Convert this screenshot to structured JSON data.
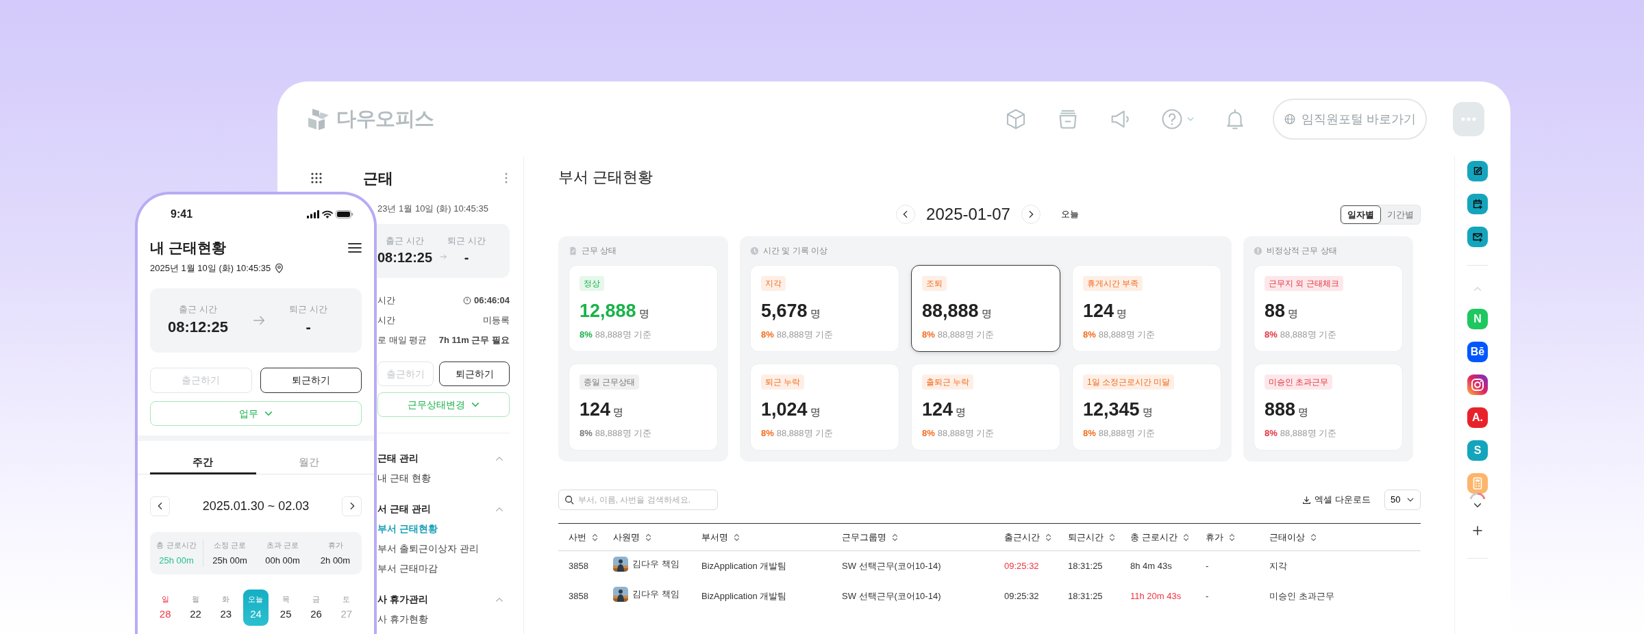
{
  "header": {
    "logo": "다우오피스",
    "portal_button": "임직원포털 바로가기"
  },
  "sidebar": {
    "title": "근태",
    "datetime": "23년 1월 10일 (화) 10:45:35",
    "clock_in_label": "출근 시간",
    "clock_in": "08:12:25",
    "clock_out_label": "퇴근 시간",
    "clock_out": "-",
    "stats": [
      {
        "label": "시간",
        "value": "06:46:04",
        "kind": "timer"
      },
      {
        "label": "시간",
        "value": "미등록",
        "kind": "plain"
      },
      {
        "label": "로 매일 평균",
        "value": "7h 11m 근무 필요",
        "kind": "bold"
      }
    ],
    "buttons": [
      {
        "label": "출근하기",
        "disabled": true
      },
      {
        "label": "퇴근하기",
        "disabled": false
      }
    ],
    "status_button": "근무상태변경",
    "menu": [
      {
        "title": "근태 관리",
        "expanded": true,
        "items": [
          {
            "label": "내 근태 현황",
            "selected": false
          }
        ]
      },
      {
        "title": "서 근태 관리",
        "expanded": true,
        "items": [
          {
            "label": "부서 근태현황",
            "selected": true
          },
          {
            "label": "부서 출퇴근이상자 관리",
            "selected": false
          },
          {
            "label": "부서 근태마감",
            "selected": false
          }
        ]
      },
      {
        "title": "사 휴가관리",
        "expanded": true,
        "items": [
          {
            "label": "사 휴가현황",
            "selected": false
          }
        ]
      }
    ]
  },
  "main": {
    "title": "부서 근태현황",
    "date": "2025-01-07",
    "today_button": "오늘",
    "view_toggle": [
      {
        "label": "일자별",
        "selected": true
      },
      {
        "label": "기간별",
        "selected": false
      }
    ],
    "groups": [
      {
        "title": "근무 상태",
        "kind": "document",
        "cards": [
          {
            "badge": "정상",
            "color": "#19b34a",
            "highlight": true,
            "count": "12,888",
            "unit": "명",
            "percent": "8%",
            "basis": "88,888명 기준",
            "selected": false
          },
          {
            "badge": "종일 근무상태",
            "color": "#777777",
            "highlight": false,
            "count": "124",
            "unit": "명",
            "percent": "8%",
            "basis": "88,888명 기준",
            "selected": false
          }
        ]
      },
      {
        "title": "시간 및 기록 이상",
        "kind": "clock",
        "cards": [
          {
            "badge": "지각",
            "color": "#f26b1d",
            "highlight": false,
            "count": "5,678",
            "unit": "명",
            "percent": "8%",
            "basis": "88,888명 기준",
            "selected": false
          },
          {
            "badge": "조퇴",
            "color": "#f26b1d",
            "highlight": false,
            "count": "88,888",
            "unit": "명",
            "percent": "8%",
            "basis": "88,888명 기준",
            "selected": true
          },
          {
            "badge": "휴게시간 부족",
            "color": "#f26b1d",
            "highlight": false,
            "count": "124",
            "unit": "명",
            "percent": "8%",
            "basis": "88,888명 기준",
            "selected": false
          },
          {
            "badge": "퇴근 누락",
            "color": "#f26b1d",
            "highlight": false,
            "count": "1,024",
            "unit": "명",
            "percent": "8%",
            "basis": "88,888명 기준",
            "selected": false
          },
          {
            "badge": "출퇴근 누락",
            "color": "#f26b1d",
            "highlight": false,
            "count": "124",
            "unit": "명",
            "percent": "8%",
            "basis": "88,888명 기준",
            "selected": false
          },
          {
            "badge": "1일 소정근로시간 미달",
            "color": "#f26b1d",
            "highlight": false,
            "count": "12,345",
            "unit": "명",
            "percent": "8%",
            "basis": "88,888명 기준",
            "selected": false
          }
        ]
      },
      {
        "title": "비정상적 근무 상태",
        "kind": "alert",
        "cards": [
          {
            "badge": "근무지 외 근태체크",
            "color": "#e5323f",
            "highlight": false,
            "count": "88",
            "unit": "명",
            "percent": "8%",
            "basis": "88,888명 기준",
            "selected": false
          },
          {
            "badge": "미승인 초과근무",
            "color": "#e5323f",
            "highlight": false,
            "count": "888",
            "unit": "명",
            "percent": "8%",
            "basis": "88,888명 기준",
            "selected": false
          }
        ]
      }
    ],
    "search": {
      "placeholder": "부서, 이름, 사번을 검색하세요."
    },
    "download_button": "엑셀 다운로드",
    "page_size": "50",
    "table": {
      "columns": [
        "사번",
        "사원명",
        "부서명",
        "근무그룹명",
        "출근시간",
        "퇴근시간",
        "총 근로시간",
        "휴가",
        "근태이상"
      ],
      "rows": [
        {
          "cells": [
            {
              "text": "3858",
              "alert": false
            },
            {
              "text": "김다우 책임",
              "alert": false
            },
            {
              "text": "BizApplication 개발팀",
              "alert": false
            },
            {
              "text": "SW 선택근무(코어10-14)",
              "alert": false
            },
            {
              "text": "09:25:32",
              "alert": true
            },
            {
              "text": "18:31:25",
              "alert": false
            },
            {
              "text": "8h 4m 43s",
              "alert": false
            },
            {
              "text": "-",
              "alert": false
            },
            {
              "text": "지각",
              "alert": false
            }
          ]
        },
        {
          "cells": [
            {
              "text": "3858",
              "alert": false
            },
            {
              "text": "김다우 책임",
              "alert": false
            },
            {
              "text": "BizApplication 개발팀",
              "alert": false
            },
            {
              "text": "SW 선택근무(코어10-14)",
              "alert": false
            },
            {
              "text": "09:25:32",
              "alert": false
            },
            {
              "text": "18:31:25",
              "alert": false
            },
            {
              "text": "11h 20m 43s",
              "alert": true
            },
            {
              "text": "-",
              "alert": false
            },
            {
              "text": "미승인 초과근무",
              "alert": false
            }
          ]
        }
      ]
    }
  },
  "rail": {
    "apps": [
      {
        "kind": "letter",
        "label": "N",
        "color": "#1ec760"
      },
      {
        "kind": "letter",
        "label": "Bē",
        "color": "#0057ff"
      },
      {
        "kind": "instagram"
      },
      {
        "kind": "letter",
        "label": "A.",
        "color": "#e8222b"
      },
      {
        "kind": "letter",
        "label": "S",
        "color": "#14a5bd"
      },
      {
        "kind": "calculator",
        "color": "#fdb56b"
      }
    ]
  },
  "phone": {
    "time": "9:41",
    "title": "내 근태현황",
    "datetime": "2025년 1월 10일 (화) 10:45:35",
    "clock_in_label": "출근 시간",
    "clock_in": "08:12:25",
    "clock_out_label": "퇴근 시간",
    "clock_out": "-",
    "buttons": [
      {
        "label": "출근하기",
        "disabled": true
      },
      {
        "label": "퇴근하기",
        "disabled": false
      }
    ],
    "status_button": "업무",
    "tabs": [
      {
        "label": "주간",
        "selected": true
      },
      {
        "label": "월간",
        "selected": false
      }
    ],
    "range": "2025.01.30 ~ 02.03",
    "summary": [
      {
        "label": "총 근로시간",
        "value": "25h 00m",
        "highlight": true
      },
      {
        "label": "소정 근로",
        "value": "25h 00m",
        "highlight": false
      },
      {
        "label": "초과 근로",
        "value": "00h 00m",
        "highlight": false
      },
      {
        "label": "휴가",
        "value": "2h 00m",
        "highlight": false
      }
    ],
    "days": [
      {
        "weekday": "일",
        "date": "28",
        "kind": "sunday",
        "selected": false
      },
      {
        "weekday": "월",
        "date": "22",
        "kind": "weekday",
        "selected": false
      },
      {
        "weekday": "화",
        "date": "23",
        "kind": "weekday",
        "selected": false
      },
      {
        "weekday": "오늘",
        "date": "24",
        "kind": "weekday",
        "selected": true
      },
      {
        "weekday": "목",
        "date": "25",
        "kind": "weekday",
        "selected": false
      },
      {
        "weekday": "금",
        "date": "26",
        "kind": "weekday",
        "selected": false
      },
      {
        "weekday": "토",
        "date": "27",
        "kind": "saturday",
        "selected": false
      }
    ]
  }
}
